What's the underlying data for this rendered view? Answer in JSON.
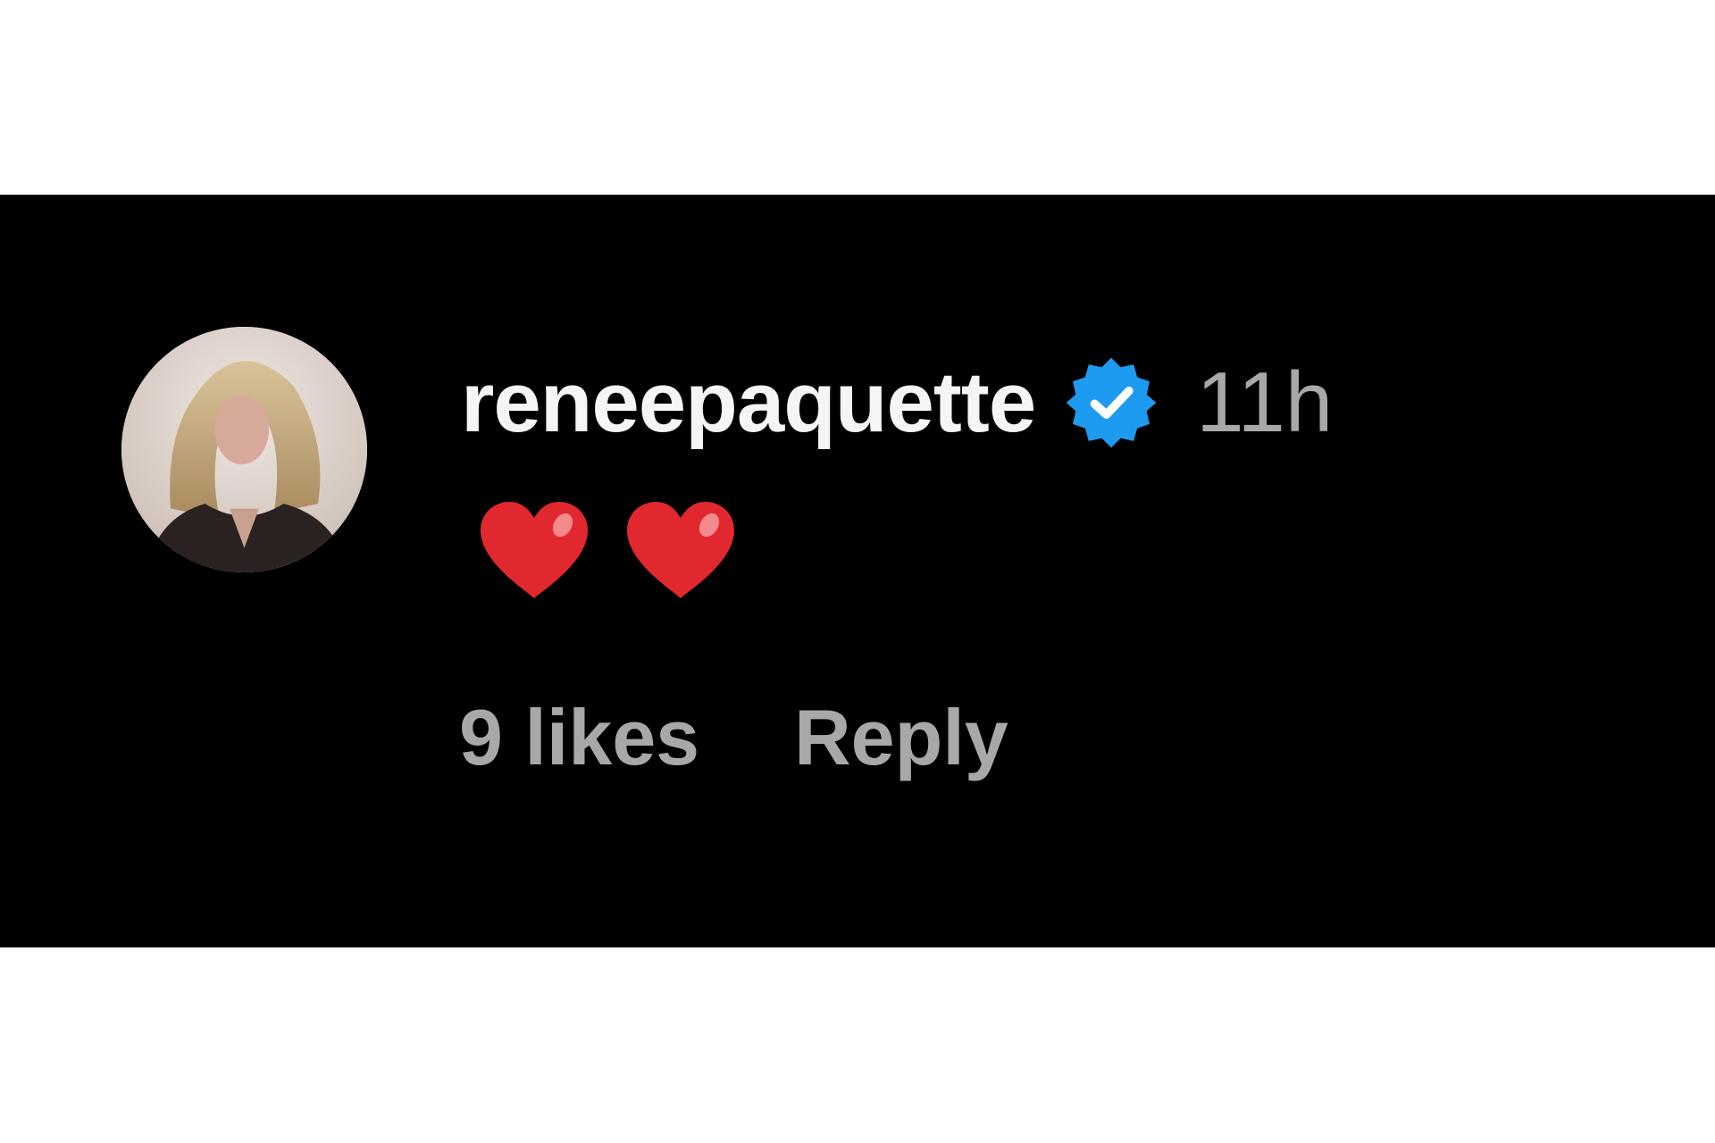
{
  "comment": {
    "username": "reneepaquette",
    "verified": true,
    "timestamp": "11h",
    "text_icons": [
      "heart-icon",
      "heart-icon"
    ],
    "likes": "9 likes",
    "reply_label": "Reply"
  },
  "colors": {
    "background": "#000000",
    "page": "#ffffff",
    "username": "#f5f5f5",
    "secondary_text": "#a8a8a8",
    "verified_badge": "#1d9bf0",
    "heart": "#e0282e"
  }
}
